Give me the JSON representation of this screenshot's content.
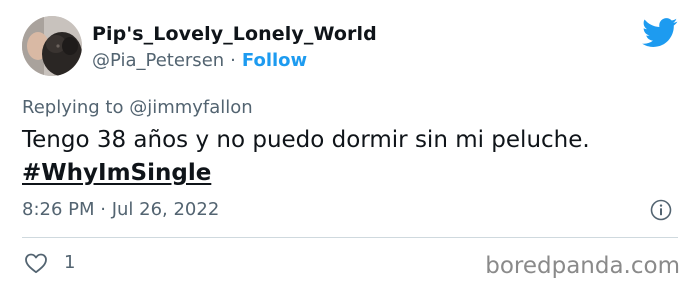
{
  "tweet": {
    "display_name": "Pip's_Lovely_Lonely_World",
    "handle": "@Pia_Petersen",
    "separator": "·",
    "follow_label": "Follow",
    "replying_to": "Replying to @jimmyfallon",
    "text": "Tengo 38 años y no puedo dormir sin mi peluche.",
    "hashtag": "#WhyImSingle",
    "timestamp": "8:26 PM · Jul 26, 2022",
    "like_count": "1",
    "colors": {
      "accent": "#1d9bf0",
      "secondary_text": "#536471",
      "primary_text": "#0f1419"
    },
    "icons": {
      "brand": "twitter-bird-icon",
      "info": "info-icon",
      "like": "heart-icon"
    }
  },
  "watermark": "boredpanda.com"
}
